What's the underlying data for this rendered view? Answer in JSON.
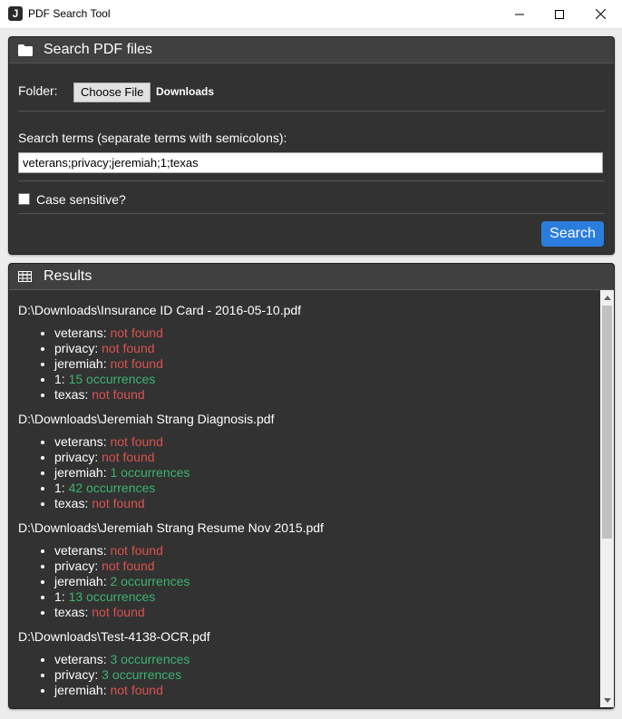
{
  "window": {
    "app_icon_letter": "J",
    "title": "PDF Search Tool"
  },
  "search_panel": {
    "title": "Search PDF files",
    "folder_label": "Folder:",
    "choose_file_label": "Choose File",
    "folder_name": "Downloads",
    "terms_label": "Search terms (separate terms with semicolons):",
    "terms_value": "veterans;privacy;jeremiah;1;texas",
    "case_sensitive_label": "Case sensitive?",
    "case_sensitive_checked": false,
    "search_button_label": "Search"
  },
  "results_panel": {
    "title": "Results",
    "files": [
      {
        "path": "D:\\Downloads\\Insurance ID Card - 2016-05-10.pdf",
        "terms": [
          {
            "term": "veterans",
            "result": "not found",
            "found": false
          },
          {
            "term": "privacy",
            "result": "not found",
            "found": false
          },
          {
            "term": "jeremiah",
            "result": "not found",
            "found": false
          },
          {
            "term": "1",
            "result": "15 occurrences",
            "found": true
          },
          {
            "term": "texas",
            "result": "not found",
            "found": false
          }
        ]
      },
      {
        "path": "D:\\Downloads\\Jeremiah Strang Diagnosis.pdf",
        "terms": [
          {
            "term": "veterans",
            "result": "not found",
            "found": false
          },
          {
            "term": "privacy",
            "result": "not found",
            "found": false
          },
          {
            "term": "jeremiah",
            "result": "1 occurrences",
            "found": true
          },
          {
            "term": "1",
            "result": "42 occurrences",
            "found": true
          },
          {
            "term": "texas",
            "result": "not found",
            "found": false
          }
        ]
      },
      {
        "path": "D:\\Downloads\\Jeremiah Strang Resume Nov 2015.pdf",
        "terms": [
          {
            "term": "veterans",
            "result": "not found",
            "found": false
          },
          {
            "term": "privacy",
            "result": "not found",
            "found": false
          },
          {
            "term": "jeremiah",
            "result": "2 occurrences",
            "found": true
          },
          {
            "term": "1",
            "result": "13 occurrences",
            "found": true
          },
          {
            "term": "texas",
            "result": "not found",
            "found": false
          }
        ]
      },
      {
        "path": "D:\\Downloads\\Test-4138-OCR.pdf",
        "terms": [
          {
            "term": "veterans",
            "result": "3 occurrences",
            "found": true
          },
          {
            "term": "privacy",
            "result": "3 occurrences",
            "found": true
          },
          {
            "term": "jeremiah",
            "result": "not found",
            "found": false
          }
        ]
      }
    ]
  },
  "colors": {
    "found": "#3cb371",
    "not_found": "#d9534f",
    "accent": "#2b7ddd",
    "panel_bg": "#323232"
  },
  "icons": {
    "folder": "folder-icon",
    "table": "table-icon"
  }
}
